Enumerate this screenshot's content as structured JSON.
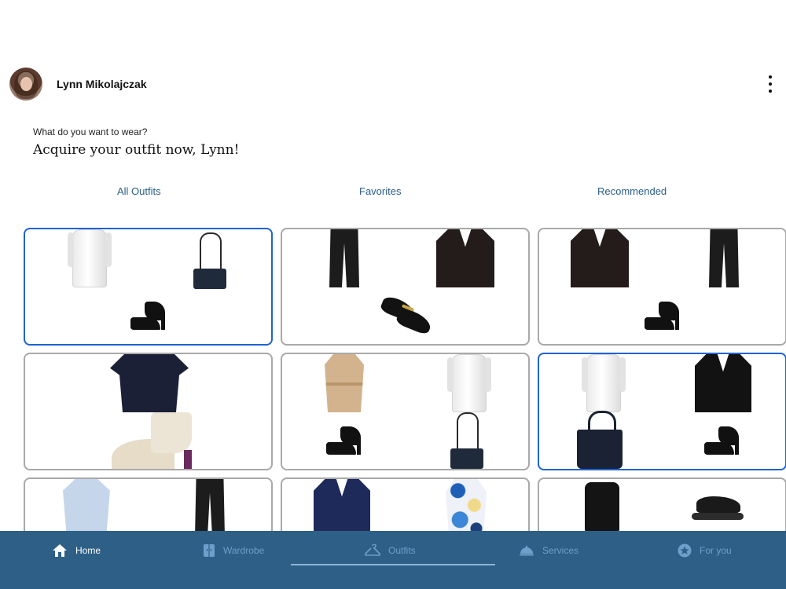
{
  "header": {
    "user_name": "Lynn Mikolajczak"
  },
  "intro": {
    "question": "What do you want to wear?",
    "greeting": "Acquire your outfit now, Lynn!"
  },
  "tabs": [
    {
      "label": "All Outfits"
    },
    {
      "label": "Favorites"
    },
    {
      "label": "Recommended"
    }
  ],
  "outfits": [
    {
      "items": [
        "white-dress",
        "black-chain-bag",
        "black-patent-pump"
      ],
      "selected": true
    },
    {
      "items": [
        "black-trousers",
        "black-blazer",
        "black-loafers"
      ],
      "selected": false
    },
    {
      "items": [
        "black-blazer",
        "black-trousers",
        "black-patent-pump"
      ],
      "selected": false
    },
    {
      "items": [
        "navy-dress",
        "cream-ankle-boot"
      ],
      "selected": false
    },
    {
      "items": [
        "beige-trench-coat",
        "white-dress",
        "black-patent-pump",
        "black-chain-bag"
      ],
      "selected": false
    },
    {
      "items": [
        "white-dress",
        "black-gold-button-blazer",
        "navy-tote-bag",
        "black-patent-pump"
      ],
      "selected": true
    },
    {
      "items": [
        "light-blue-blouse",
        "black-trousers"
      ],
      "selected": false
    },
    {
      "items": [
        "navy-blazer",
        "blue-print-dress"
      ],
      "selected": false
    },
    {
      "items": [
        "black-camisole",
        "black-sneaker"
      ],
      "selected": false
    }
  ],
  "bottom_nav": [
    {
      "label": "Home",
      "icon": "home-icon",
      "active": true
    },
    {
      "label": "Wardrobe",
      "icon": "wardrobe-icon",
      "active": false
    },
    {
      "label": "Outfits",
      "icon": "hanger-icon",
      "active": false
    },
    {
      "label": "Services",
      "icon": "cloche-icon",
      "active": false
    },
    {
      "label": "For you",
      "icon": "star-badge-icon",
      "active": false
    }
  ],
  "colors": {
    "accent": "#1f63d6",
    "tab_text": "#2a5e8a",
    "nav_background": "#2e5f87",
    "nav_inactive": "#6e9fca"
  }
}
